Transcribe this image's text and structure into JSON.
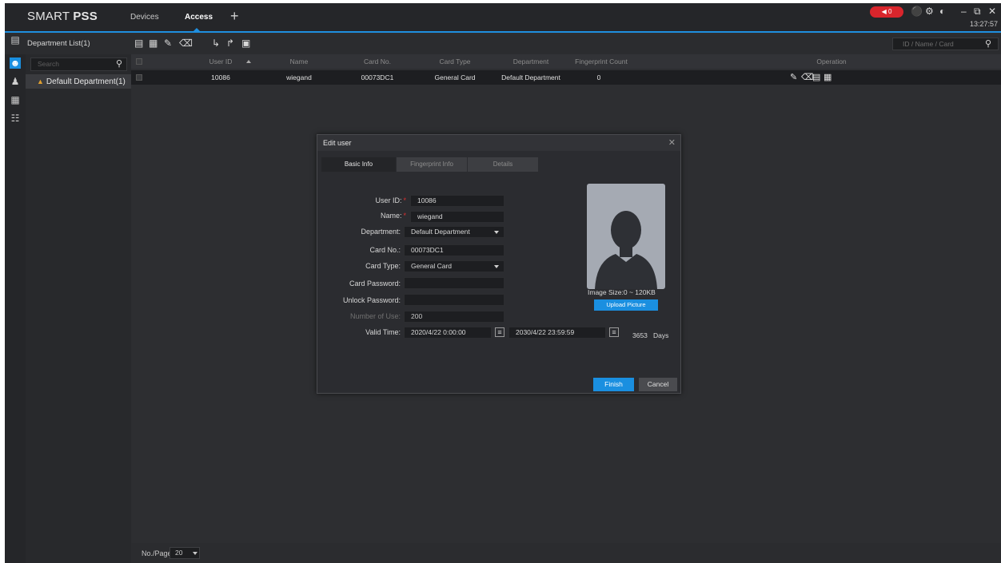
{
  "app": {
    "brand_light": "SMART ",
    "brand_bold": "PSS",
    "nav": {
      "devices": "Devices",
      "access": "Access",
      "add": "+"
    },
    "alarm_count": "◀ 0",
    "clock": "13:27:57"
  },
  "toolbar": {
    "dept_list_title": "Department List(1)",
    "search_placeholder": "ID / Name / Card"
  },
  "department": {
    "search_placeholder": "Search",
    "item_label": "Default Department(1)"
  },
  "table": {
    "headers": {
      "user_id": "User ID",
      "name": "Name",
      "card_no": "Card No.",
      "card_type": "Card Type",
      "department": "Department",
      "fingerprint_count": "Fingerprint Count",
      "operation": "Operation"
    },
    "rows": [
      {
        "user_id": "10086",
        "name": "wiegand",
        "card_no": "00073DC1",
        "card_type": "General Card",
        "department": "Default Department",
        "fingerprint_count": "0"
      }
    ]
  },
  "footer": {
    "per_page_label": "No./Page",
    "per_page_value": "20"
  },
  "dialog": {
    "title": "Edit user",
    "tabs": {
      "basic": "Basic Info",
      "fingerprint": "Fingerprint Info",
      "details": "Details"
    },
    "labels": {
      "user_id": "User ID:",
      "name": "Name:",
      "department": "Department:",
      "card_no": "Card No.:",
      "card_type": "Card Type:",
      "card_password": "Card Password:",
      "unlock_password": "Unlock Password:",
      "number_of_use": "Number of Use:",
      "valid_time": "Valid Time:"
    },
    "values": {
      "user_id": "10086",
      "name": "wiegand",
      "department": "Default Department",
      "card_no": "00073DC1",
      "card_type": "General Card",
      "card_password": "",
      "unlock_password": "",
      "number_of_use": "200",
      "valid_start": "2020/4/22 0:00:00",
      "valid_end": "2030/4/22 23:59:59"
    },
    "days_value": "3653",
    "days_label": "Days",
    "image_size": "Image Size:0 ~ 120KB",
    "upload_label": "Upload Picture",
    "finish_label": "Finish",
    "cancel_label": "Cancel"
  },
  "colors": {
    "accent": "#1a8fe0",
    "alarm": "#d9252c",
    "background": "#2d2e31"
  }
}
